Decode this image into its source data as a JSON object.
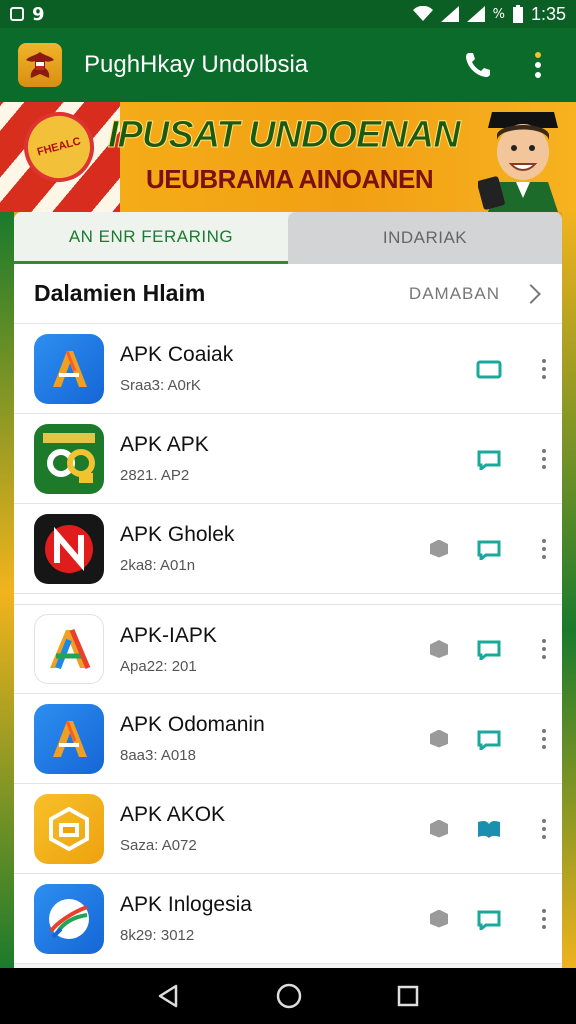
{
  "status_bar": {
    "time": "1:35",
    "left_icons": [
      "sim-icon",
      "notification-icon"
    ],
    "right_icons": [
      "wifi-icon",
      "signal-icon",
      "signal-icon",
      "percent-icon",
      "battery-icon"
    ],
    "percent_glyph": "%",
    "sim_glyph": "9"
  },
  "app_bar": {
    "title": "PughHkay Undolbsia",
    "logo_icon": "garuda-emblem-icon",
    "call_icon": "phone-icon",
    "menu_icon": "overflow-menu-icon"
  },
  "banner": {
    "medal_text": "FHEALC",
    "headline": "IPUSAT UNDOENAN",
    "subline": "UEUBRAMA AINOANEN"
  },
  "tabs": [
    {
      "label": "AN ENR FERARING",
      "active": true
    },
    {
      "label": "INDARIAK",
      "active": false
    }
  ],
  "section": {
    "title": "Dalamien Hlaim",
    "link": "DAMABAN"
  },
  "apps": [
    {
      "name": "APK Coaiak",
      "meta": "Sraa3: A0rK",
      "icon": "blue-a-icon",
      "has_box": false,
      "action_color": "#1aa89a"
    },
    {
      "name": "APK APK",
      "meta": "2821. AP2",
      "icon": "green-90-icon",
      "has_box": false,
      "action_color": "#1aa89a"
    },
    {
      "name": "APK Gholek",
      "meta": "2ka8: A01n",
      "icon": "red-n-icon",
      "has_box": true,
      "action_color": "#1aa89a"
    },
    {
      "name": "APK-IAPK",
      "meta": "Apa22: 201",
      "icon": "white-a-icon",
      "has_box": true,
      "action_color": "#1aa89a"
    },
    {
      "name": "APK Odomanin",
      "meta": "8aa3: A018",
      "icon": "blue-a-icon",
      "has_box": true,
      "action_color": "#1aa89a"
    },
    {
      "name": "APK AKOK",
      "meta": "Saza: A072",
      "icon": "yellow-box-icon",
      "has_box": true,
      "action_color": "#1a8fb0"
    },
    {
      "name": "APK Inlogesia",
      "meta": "8k29: 3012",
      "icon": "blue-globe-icon",
      "has_box": true,
      "action_color": "#1aa89a"
    }
  ],
  "nav": {
    "back_icon": "back-icon",
    "home_icon": "home-icon",
    "recents_icon": "recents-icon"
  }
}
